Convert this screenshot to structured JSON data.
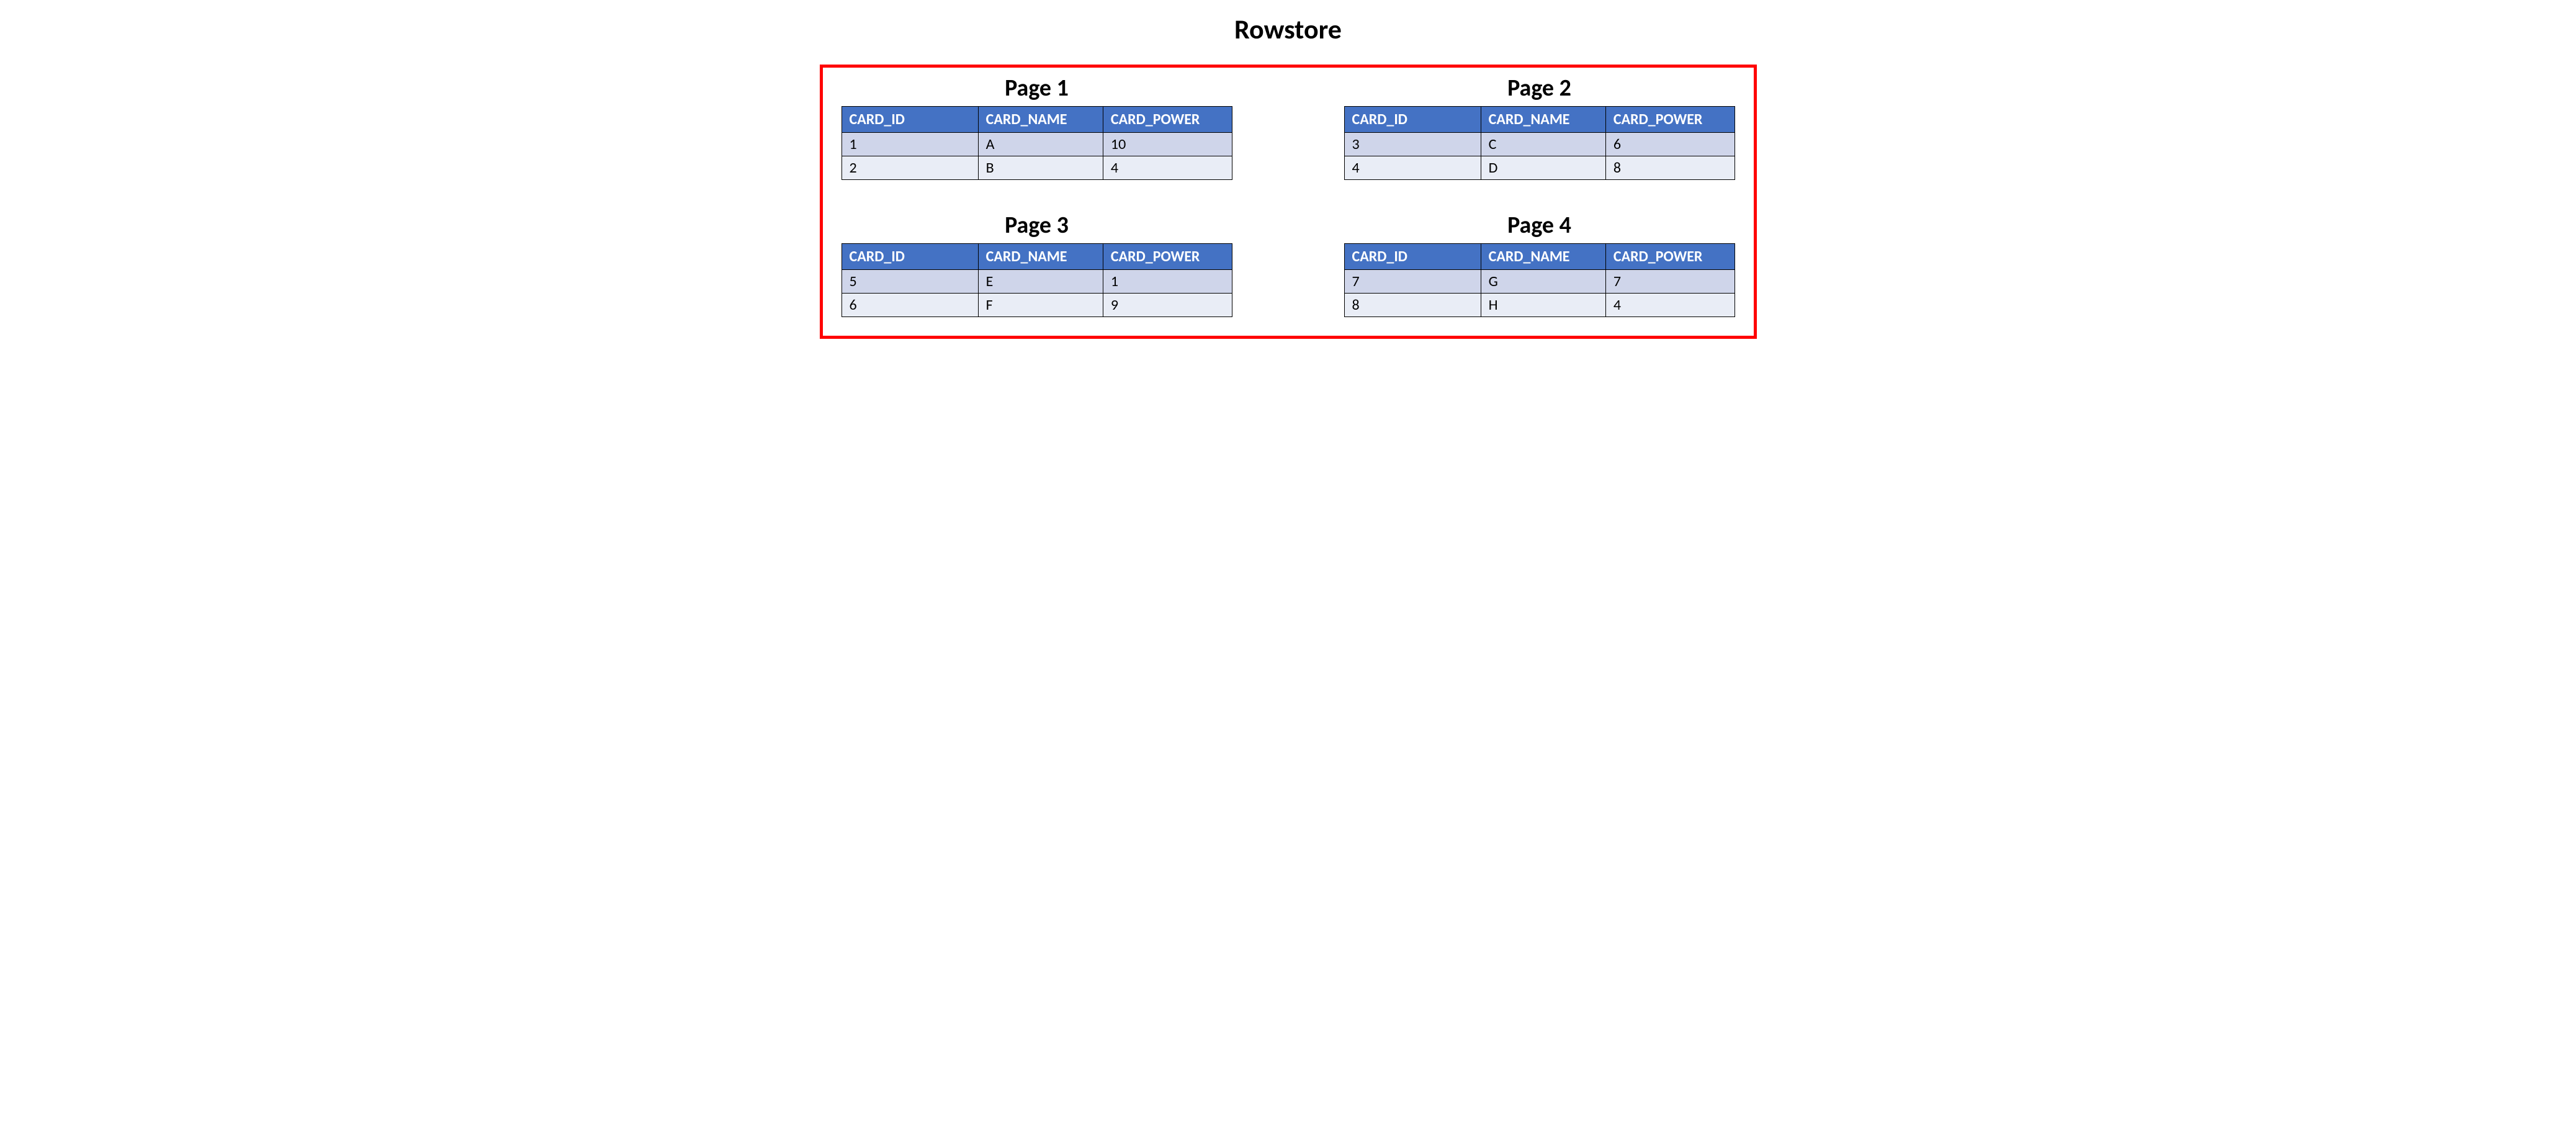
{
  "title": "Rowstore",
  "columns": [
    "CARD_ID",
    "CARD_NAME",
    "CARD_POWER"
  ],
  "pages": [
    {
      "title": "Page 1",
      "rows": [
        {
          "card_id": "1",
          "card_name": "A",
          "card_power": "10"
        },
        {
          "card_id": "2",
          "card_name": "B",
          "card_power": "4"
        }
      ]
    },
    {
      "title": "Page 2",
      "rows": [
        {
          "card_id": "3",
          "card_name": "C",
          "card_power": "6"
        },
        {
          "card_id": "4",
          "card_name": "D",
          "card_power": "8"
        }
      ]
    },
    {
      "title": "Page 3",
      "rows": [
        {
          "card_id": "5",
          "card_name": "E",
          "card_power": "1"
        },
        {
          "card_id": "6",
          "card_name": "F",
          "card_power": "9"
        }
      ]
    },
    {
      "title": "Page 4",
      "rows": [
        {
          "card_id": "7",
          "card_name": "G",
          "card_power": "7"
        },
        {
          "card_id": "8",
          "card_name": "H",
          "card_power": "4"
        }
      ]
    }
  ]
}
